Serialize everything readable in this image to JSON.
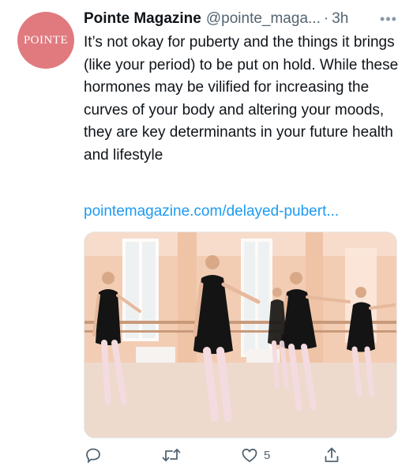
{
  "tweet": {
    "avatar_text": "POINTE",
    "author_name": "Pointe Magazine",
    "author_handle": "@pointe_maga...",
    "separator": "·",
    "time": "3h",
    "more_icon": "more-horizontal-icon",
    "text": "It’s not okay for puberty and the things it brings (like your period) to be put on hold. While these hormones may be vilified for increasing the curves of your body and altering your moods, they are key determinants in your future health and lifestyle",
    "link_text": "pointemagazine.com/delayed-pubert...",
    "avatar_color": "#e07a7f",
    "link_color": "#1d9bf0"
  },
  "actions": {
    "reply_icon": "reply-icon",
    "retweet_icon": "retweet-icon",
    "like_icon": "heart-icon",
    "like_count": "5",
    "share_icon": "share-icon"
  }
}
